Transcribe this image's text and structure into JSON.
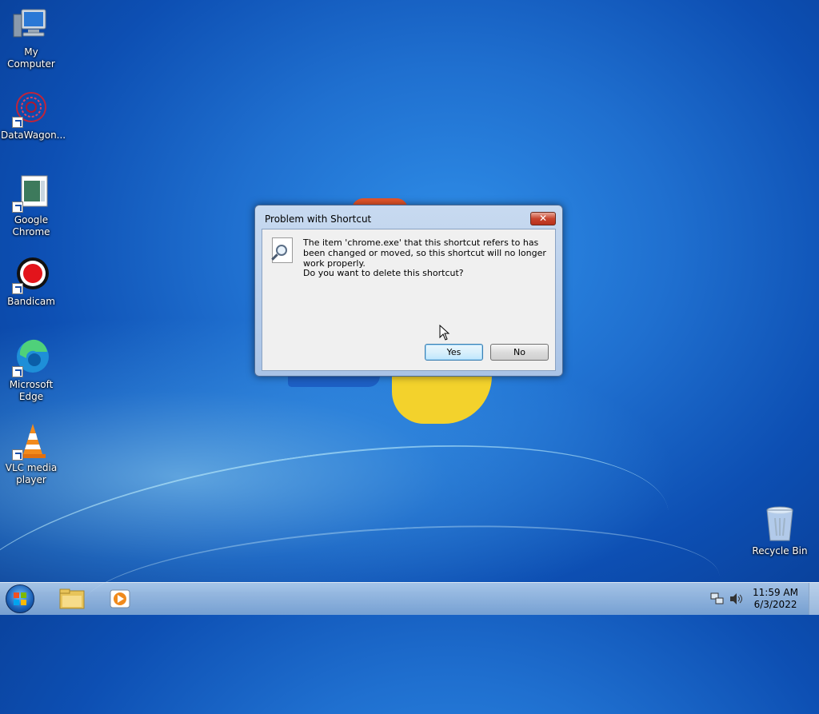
{
  "desktop": {
    "icons": [
      {
        "label": "My Computer"
      },
      {
        "label": "DataWagon..."
      },
      {
        "label": "Google Chrome"
      },
      {
        "label": "Bandicam"
      },
      {
        "label": "Microsoft Edge"
      },
      {
        "label": "VLC media player"
      },
      {
        "label": "Recycle Bin"
      }
    ]
  },
  "dialog": {
    "title": "Problem with Shortcut",
    "close_label": "✕",
    "message": "The item 'chrome.exe' that this shortcut refers to has been changed or moved, so this shortcut will no longer work properly.",
    "question": "Do you want to delete this shortcut?",
    "yes_label": "Yes",
    "no_label": "No"
  },
  "taskbar": {
    "clock_time": "11:59 AM",
    "clock_date": "6/3/2022"
  },
  "colors": {
    "desktop_bg": "#1f6fcf",
    "dialog_frame": "#c8daf0",
    "close_button": "#c8452e",
    "taskbar": "#a9c3e6"
  }
}
